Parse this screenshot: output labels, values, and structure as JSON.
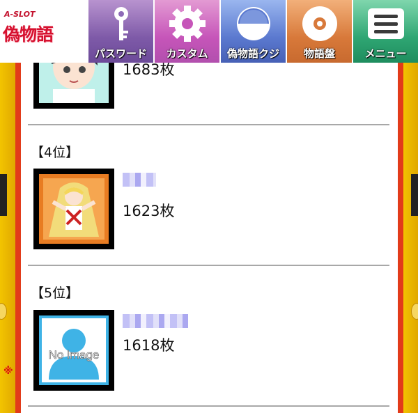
{
  "header": {
    "logo_small": "A-SLOT",
    "logo_text": "偽物語",
    "nav": [
      {
        "label": "パスワード",
        "icon": "key-icon",
        "color": "#7e5aa8"
      },
      {
        "label": "カスタム",
        "icon": "gear-icon",
        "color": "#c655b9"
      },
      {
        "label": "偽物語クジ",
        "icon": "half-circle-icon",
        "color": "#5b79cf"
      },
      {
        "label": "物語盤",
        "icon": "disc-icon",
        "color": "#d8793a"
      },
      {
        "label": "メニュー",
        "icon": "menu-icon",
        "color": "#2fa673"
      }
    ]
  },
  "ranking": [
    {
      "rank": "",
      "count": "1683枚",
      "thumb": "character-black-hair-icon"
    },
    {
      "rank": "【4位】",
      "count": "1623枚",
      "thumb": "character-blonde-icon"
    },
    {
      "rank": "【5位】",
      "count": "1618枚",
      "thumb": "no-image-icon",
      "noimage_text": "No image"
    }
  ],
  "frame": {
    "mark": "※"
  },
  "colors": {
    "frame_red": "#e23b1a",
    "frame_yellow": "#e9b400",
    "noimage_blue": "#3fb3e6"
  }
}
